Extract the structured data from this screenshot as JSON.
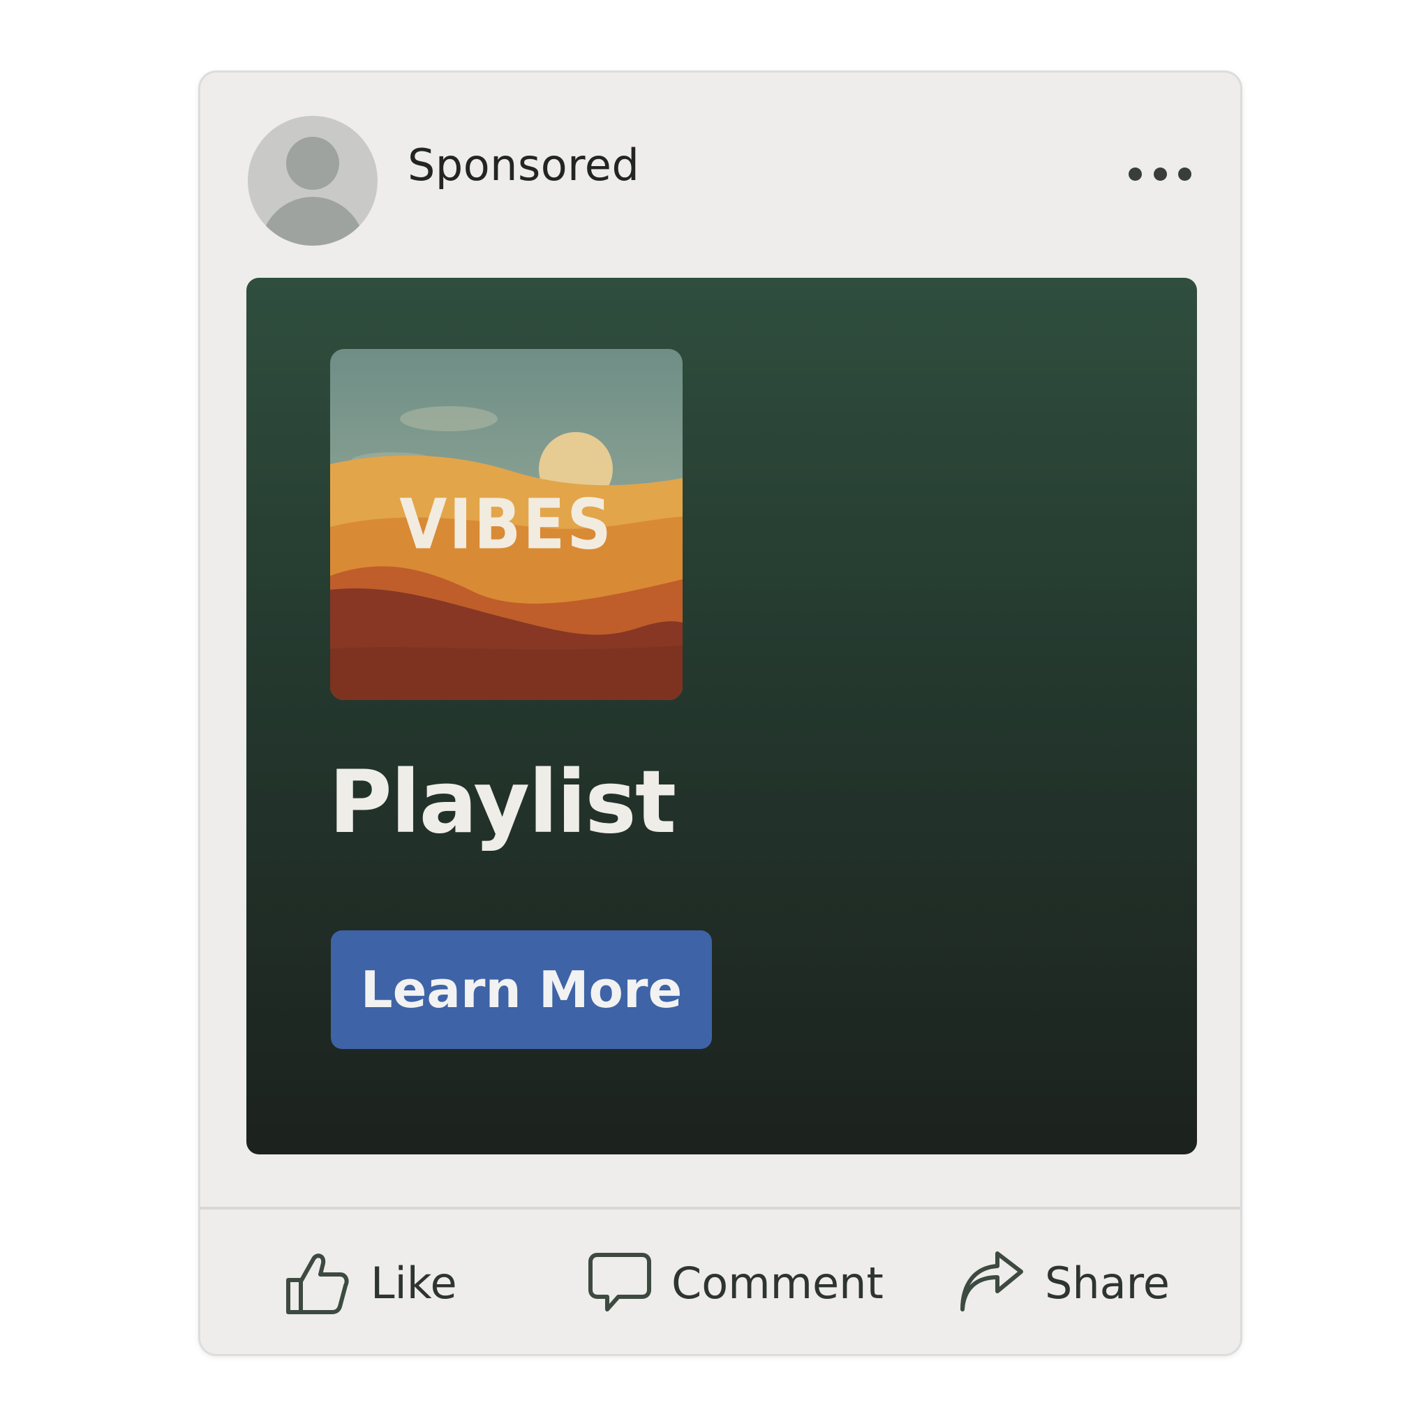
{
  "post": {
    "sponsored_label": "Sponsored",
    "more_icon": "more-options-icon"
  },
  "ad": {
    "cover_title": "VIBES",
    "headline": "Playlist",
    "cta_label": "Learn More",
    "colors": {
      "background_top": "#2f4e3e",
      "background_bottom": "#1c221e",
      "cta": "#3e63a6"
    }
  },
  "actions": {
    "like": {
      "label": "Like",
      "icon": "thumbs-up-icon"
    },
    "comment": {
      "label": "Comment",
      "icon": "speech-bubble-icon"
    },
    "share": {
      "label": "Share",
      "icon": "share-arrow-icon"
    }
  }
}
